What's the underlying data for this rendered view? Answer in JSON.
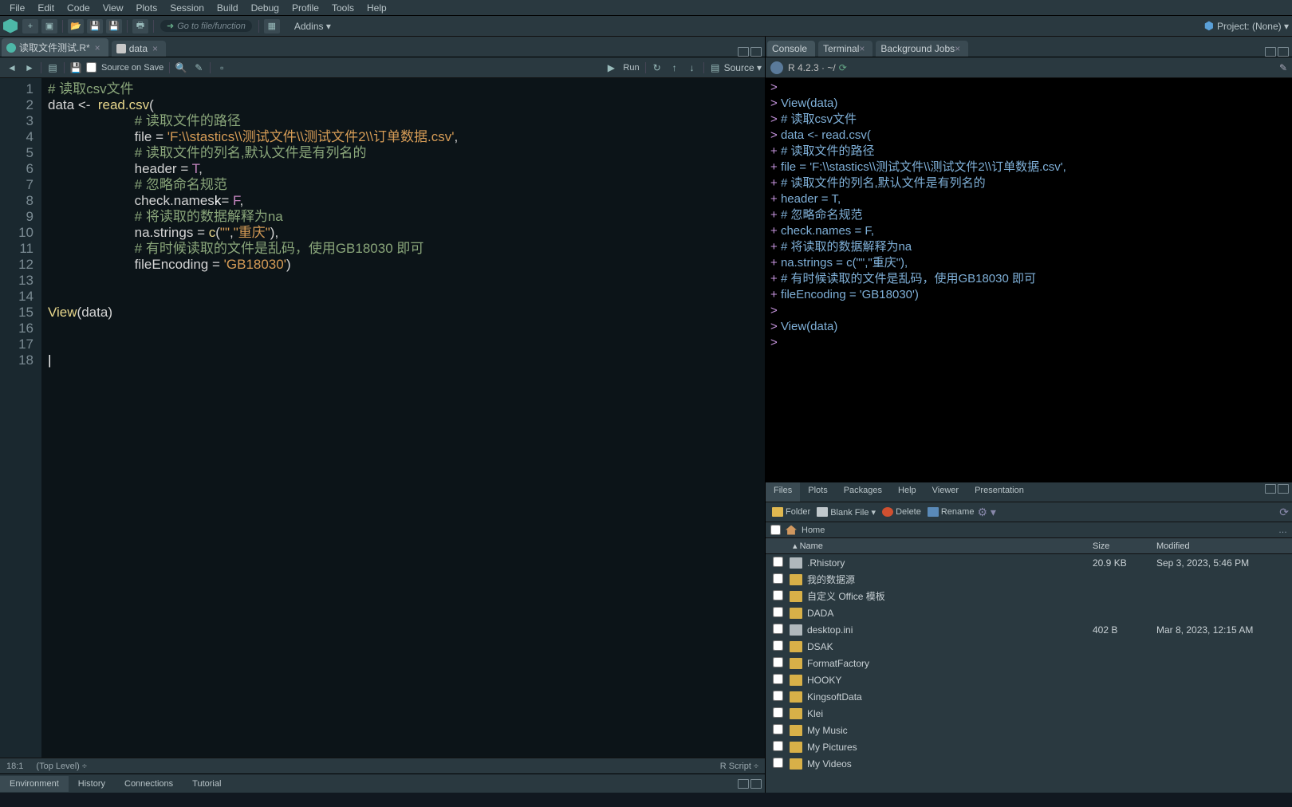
{
  "menu": [
    "File",
    "Edit",
    "Code",
    "View",
    "Plots",
    "Session",
    "Build",
    "Debug",
    "Profile",
    "Tools",
    "Help"
  ],
  "toolbar": {
    "goto_placeholder": "Go to file/function",
    "addins": "Addins ▾",
    "project": "Project: (None) ▾"
  },
  "source": {
    "tabs": [
      {
        "label": "读取文件测试.R*",
        "type": "r",
        "active": true
      },
      {
        "label": "data",
        "type": "data",
        "active": false
      }
    ],
    "source_on_save": "Source on Save",
    "run": "Run",
    "source_btn": "Source ▾",
    "lines": [
      {
        "n": 1,
        "tokens": [
          [
            "c-comment",
            "# 读取csv文件"
          ]
        ]
      },
      {
        "n": 2,
        "tokens": [
          [
            "c-id",
            "data "
          ],
          [
            "c-op",
            "<-  "
          ],
          [
            "c-kw",
            "read.csv"
          ],
          [
            "c-op",
            "("
          ]
        ]
      },
      {
        "n": 3,
        "tokens": [
          [
            "c-id",
            "                       "
          ],
          [
            "c-comment",
            "# 读取文件的路径"
          ]
        ]
      },
      {
        "n": 4,
        "tokens": [
          [
            "c-id",
            "                       "
          ],
          [
            "c-id",
            "file "
          ],
          [
            "c-op",
            "= "
          ],
          [
            "c-str",
            "'F:\\\\stastics\\\\测试文件\\\\测试文件2\\\\订单数据.csv'"
          ],
          [
            "c-op",
            ","
          ]
        ]
      },
      {
        "n": 5,
        "tokens": [
          [
            "c-id",
            "                       "
          ],
          [
            "c-comment",
            "# 读取文件的列名,默认文件是有列名的"
          ]
        ]
      },
      {
        "n": 6,
        "tokens": [
          [
            "c-id",
            "                       "
          ],
          [
            "c-id",
            "header "
          ],
          [
            "c-op",
            "= "
          ],
          [
            "c-const",
            "T"
          ],
          [
            "c-op",
            ","
          ]
        ]
      },
      {
        "n": 7,
        "tokens": [
          [
            "c-id",
            "                       "
          ],
          [
            "c-comment",
            "# 忽略命名规范"
          ]
        ]
      },
      {
        "n": 8,
        "tokens": [
          [
            "c-id",
            "                       "
          ],
          [
            "c-id",
            "check.names"
          ],
          [
            "cursor-mark",
            "k"
          ],
          [
            "c-op",
            "= "
          ],
          [
            "c-const",
            "F"
          ],
          [
            "c-op",
            ","
          ]
        ]
      },
      {
        "n": 9,
        "tokens": [
          [
            "c-id",
            "                       "
          ],
          [
            "c-comment",
            "# 将读取的数据解释为na"
          ]
        ]
      },
      {
        "n": 10,
        "tokens": [
          [
            "c-id",
            "                       "
          ],
          [
            "c-id",
            "na.strings "
          ],
          [
            "c-op",
            "= "
          ],
          [
            "c-kw",
            "c"
          ],
          [
            "c-op",
            "("
          ],
          [
            "c-str",
            "\"\""
          ],
          [
            "c-op",
            ","
          ],
          [
            "c-str",
            "\"重庆\""
          ],
          [
            "c-op",
            "),"
          ]
        ]
      },
      {
        "n": 11,
        "tokens": [
          [
            "c-id",
            "                       "
          ],
          [
            "c-comment",
            "# 有时候读取的文件是乱码，使用GB18030 即可"
          ]
        ]
      },
      {
        "n": 12,
        "tokens": [
          [
            "c-id",
            "                       "
          ],
          [
            "c-id",
            "fileEncoding "
          ],
          [
            "c-op",
            "= "
          ],
          [
            "c-str",
            "'GB18030'"
          ],
          [
            "c-op",
            ")"
          ]
        ]
      },
      {
        "n": 13,
        "tokens": []
      },
      {
        "n": 14,
        "tokens": []
      },
      {
        "n": 15,
        "tokens": [
          [
            "c-kw",
            "View"
          ],
          [
            "c-op",
            "("
          ],
          [
            "c-id",
            "data"
          ],
          [
            "c-op",
            ")"
          ]
        ]
      },
      {
        "n": 16,
        "tokens": []
      },
      {
        "n": 17,
        "tokens": []
      },
      {
        "n": 18,
        "tokens": [
          [
            "cursor-mark",
            "|"
          ]
        ]
      }
    ],
    "status_pos": "18:1",
    "status_scope": "(Top Level) ÷",
    "status_lang": "R Script ÷"
  },
  "bottom_left_tabs": [
    "Environment",
    "History",
    "Connections",
    "Tutorial"
  ],
  "bottom_left_active": 0,
  "console": {
    "tabs": [
      "Console",
      "Terminal",
      "Background Jobs"
    ],
    "active": 0,
    "version": "R 4.2.3 · ~/ ",
    "lines": [
      "> ",
      "> View(data)",
      "> # 读取csv文件",
      "> data <-  read.csv(",
      "+                    # 读取文件的路径",
      "+                    file = 'F:\\\\stastics\\\\测试文件\\\\测试文件2\\\\订单数据.csv',",
      "+                    # 读取文件的列名,默认文件是有列名的",
      "+                    header = T,",
      "+                    # 忽略命名规范",
      "+                    check.names = F,",
      "+                    # 将读取的数据解释为na",
      "+                    na.strings = c(\"\",\"重庆\"),",
      "+                    # 有时候读取的文件是乱码，使用GB18030 即可",
      "+                    fileEncoding = 'GB18030')",
      "> ",
      "> View(data)",
      "> "
    ]
  },
  "files": {
    "tabs": [
      "Files",
      "Plots",
      "Packages",
      "Help",
      "Viewer",
      "Presentation"
    ],
    "active": 0,
    "buttons": {
      "new_folder": "Folder",
      "new_file": "Blank File ▾",
      "delete": "Delete",
      "rename": "Rename"
    },
    "breadcrumb": "Home",
    "headers": {
      "name": "Name",
      "size": "Size",
      "modified": "Modified"
    },
    "rows": [
      {
        "icon": "file",
        "name": ".Rhistory",
        "size": "20.9 KB",
        "modified": "Sep 3, 2023, 5:46 PM"
      },
      {
        "icon": "folder",
        "name": "我的数据源",
        "size": "",
        "modified": ""
      },
      {
        "icon": "folder",
        "name": "自定义 Office 模板",
        "size": "",
        "modified": ""
      },
      {
        "icon": "folder",
        "name": "DADA",
        "size": "",
        "modified": ""
      },
      {
        "icon": "file",
        "name": "desktop.ini",
        "size": "402 B",
        "modified": "Mar 8, 2023, 12:15 AM"
      },
      {
        "icon": "folder",
        "name": "DSAK",
        "size": "",
        "modified": ""
      },
      {
        "icon": "folder",
        "name": "FormatFactory",
        "size": "",
        "modified": ""
      },
      {
        "icon": "folder",
        "name": "HOOKY",
        "size": "",
        "modified": ""
      },
      {
        "icon": "folder",
        "name": "KingsoftData",
        "size": "",
        "modified": ""
      },
      {
        "icon": "folder",
        "name": "Klei",
        "size": "",
        "modified": ""
      },
      {
        "icon": "folder",
        "name": "My Music",
        "size": "",
        "modified": ""
      },
      {
        "icon": "folder",
        "name": "My Pictures",
        "size": "",
        "modified": ""
      },
      {
        "icon": "folder",
        "name": "My Videos",
        "size": "",
        "modified": ""
      }
    ]
  }
}
